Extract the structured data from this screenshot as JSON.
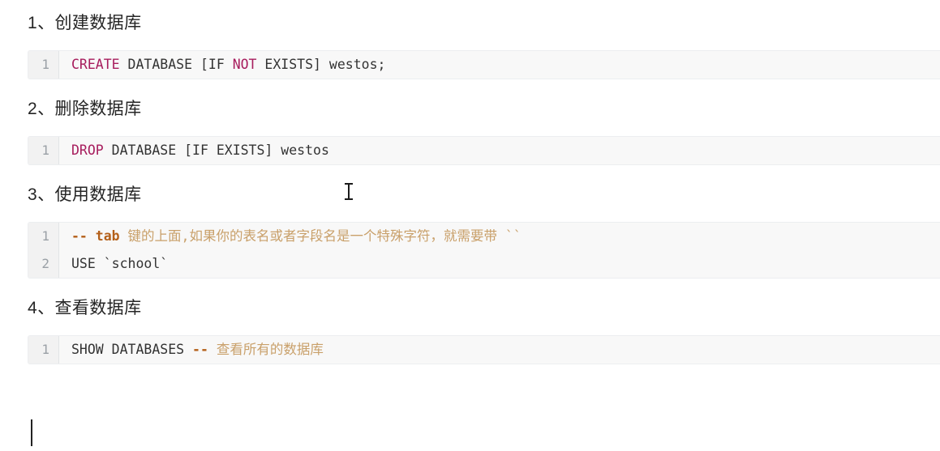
{
  "document": {
    "sections": [
      {
        "heading": "1、创建数据库",
        "code": {
          "lines": [
            {
              "number": "1",
              "tokens": [
                {
                  "text": "CREATE",
                  "type": "keyword"
                },
                {
                  "text": " DATABASE [IF ",
                  "type": "plain"
                },
                {
                  "text": "NOT",
                  "type": "keyword"
                },
                {
                  "text": " EXISTS] westos;",
                  "type": "plain"
                }
              ],
              "plain_text": "CREATE DATABASE [IF NOT EXISTS] westos;"
            }
          ]
        }
      },
      {
        "heading": "2、删除数据库",
        "code": {
          "lines": [
            {
              "number": "1",
              "tokens": [
                {
                  "text": "DROP",
                  "type": "keyword"
                },
                {
                  "text": " DATABASE [IF EXISTS] westos",
                  "type": "plain"
                }
              ],
              "plain_text": "DROP DATABASE [IF EXISTS] westos"
            }
          ]
        }
      },
      {
        "heading": "3、使用数据库",
        "code": {
          "lines": [
            {
              "number": "1",
              "tokens": [
                {
                  "text": "-- tab",
                  "type": "comment-marker"
                },
                {
                  "text": " 键的上面,如果你的表名或者字段名是一个特殊字符，就需要带 ``",
                  "type": "comment-cn"
                }
              ],
              "plain_text": "-- tab 键的上面,如果你的表名或者字段名是一个特殊字符，就需要带 ``"
            },
            {
              "number": "2",
              "tokens": [
                {
                  "text": "USE `school`",
                  "type": "plain"
                }
              ],
              "plain_text": "USE `school`"
            }
          ]
        }
      },
      {
        "heading": "4、查看数据库",
        "code": {
          "lines": [
            {
              "number": "1",
              "tokens": [
                {
                  "text": "SHOW DATABASES ",
                  "type": "plain"
                },
                {
                  "text": "--",
                  "type": "comment-marker"
                },
                {
                  "text": " 查看所有的数据库",
                  "type": "comment-cn"
                }
              ],
              "plain_text": "SHOW DATABASES -- 查看所有的数据库"
            }
          ]
        }
      }
    ]
  },
  "cursors": {
    "text_caret_visible": true,
    "mouse_pointer_shape": "i-beam-cursor"
  },
  "colors": {
    "keyword": "#a71d5d",
    "plain_code": "#333333",
    "comment_marker": "#b4601a",
    "comment_text": "#c9a06a",
    "code_background": "#f8f8f8",
    "gutter_background": "#f2f2f2",
    "line_number": "#9aa0a6",
    "heading_text": "#252525",
    "page_background": "#ffffff"
  }
}
